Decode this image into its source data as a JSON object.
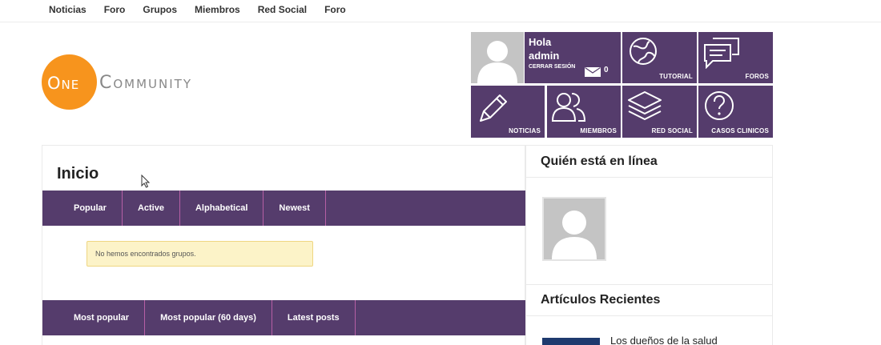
{
  "topnav": {
    "items": [
      "Noticias",
      "Foro",
      "Grupos",
      "Miembros",
      "Red Social",
      "Foro"
    ]
  },
  "logo": {
    "one": "One",
    "community": "Community"
  },
  "user": {
    "greeting": "Hola",
    "name": "admin",
    "logout": "CERRAR SESIÓN",
    "messages": "0"
  },
  "tiles": {
    "tutorial": "TUTORIAL",
    "foros": "FOROS",
    "noticias": "NOTICIAS",
    "miembros": "MIEMBROS",
    "red_social": "RED SOCIAL",
    "casos": "CASOS CLINICOS"
  },
  "main": {
    "title": "Inicio",
    "group_tabs": [
      "Popular",
      "Active",
      "Alphabetical",
      "Newest"
    ],
    "notice": "No hemos encontrados grupos.",
    "forum_tabs": [
      "Most popular",
      "Most popular (60 days)",
      "Latest posts"
    ]
  },
  "sidebar": {
    "online_title": "Quién está en línea",
    "articles_title": "Artículos Recientes",
    "article_1": "Los dueños de la salud"
  },
  "colors": {
    "accent": "#553c6c",
    "logo_orange": "#f7941d",
    "tab_divider": "#b65fa5",
    "notice_bg": "#fcf3c8"
  }
}
